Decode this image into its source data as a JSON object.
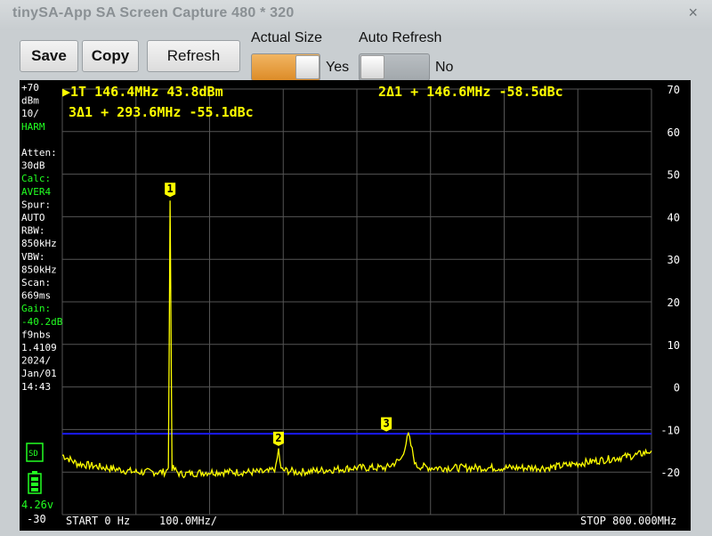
{
  "window": {
    "title": "tinySA-App SA Screen Capture   480 * 320",
    "close_glyph": "×"
  },
  "toolbar": {
    "save_label": "Save",
    "copy_label": "Copy",
    "refresh_label": "Refresh"
  },
  "actual_size": {
    "label": "Actual Size",
    "state_text": "Yes",
    "on": true
  },
  "auto_refresh": {
    "label": "Auto Refresh",
    "state_text": "No",
    "on": false
  },
  "colors": {
    "trace": "#ffff00",
    "marker_text": "#ffff00",
    "left_text": "#ffffff",
    "green_text": "#22ff22",
    "grid": "#555555",
    "threshold_line": "#1a1aff",
    "toggle_on": "#e39a33"
  },
  "screen": {
    "marker_line1": "▶1T  146.4MHz 43.8dBm",
    "marker_line2": "3Δ1 +  293.6MHz -55.1dBc",
    "marker_line3": "2Δ1 +  146.6MHz -58.5dBc",
    "left_panel": [
      {
        "text": "+70",
        "color": "white"
      },
      {
        "text": "dBm",
        "color": "white"
      },
      {
        "text": "10/",
        "color": "white"
      },
      {
        "text": "HARM",
        "color": "green"
      },
      {
        "text": "",
        "color": "white"
      },
      {
        "text": "Atten:",
        "color": "white"
      },
      {
        "text": "30dB",
        "color": "white"
      },
      {
        "text": "Calc:",
        "color": "green"
      },
      {
        "text": "AVER4",
        "color": "green"
      },
      {
        "text": "Spur:",
        "color": "white"
      },
      {
        "text": "AUTO",
        "color": "white"
      },
      {
        "text": "RBW:",
        "color": "white"
      },
      {
        "text": "850kHz",
        "color": "white"
      },
      {
        "text": "VBW:",
        "color": "white"
      },
      {
        "text": "850kHz",
        "color": "white"
      },
      {
        "text": "Scan:",
        "color": "white"
      },
      {
        "text": "669ms",
        "color": "white"
      },
      {
        "text": "Gain:",
        "color": "green"
      },
      {
        "text": "-40.2dB",
        "color": "green"
      },
      {
        "text": "f9nbs",
        "color": "white"
      },
      {
        "text": "1.4109",
        "color": "white"
      },
      {
        "text": "2024/",
        "color": "white"
      },
      {
        "text": "Jan/01",
        "color": "white"
      },
      {
        "text": "14:43",
        "color": "white"
      }
    ],
    "sd_label": "SD",
    "battery_voltage": "4.26v",
    "bottom_left_value": "-30",
    "footer_start": "START 0 Hz",
    "footer_div": "100.0MHz/",
    "footer_stop": "STOP 800.000MHz",
    "threshold_dbm": -11
  },
  "chart_data": {
    "type": "line",
    "x_unit": "MHz",
    "y_unit": "dBm",
    "xlim": [
      0,
      800
    ],
    "ylim": [
      -30,
      70
    ],
    "y_ticks": [
      70,
      60,
      50,
      40,
      30,
      20,
      10,
      0,
      -10,
      -20
    ],
    "grid": true,
    "series": [
      {
        "x": [
          0,
          20,
          40,
          60,
          80,
          100,
          120,
          140,
          144,
          146.4,
          149,
          160,
          200,
          240,
          280,
          290,
          293.6,
          297,
          320,
          360,
          400,
          440,
          460,
          470,
          480,
          500,
          540,
          580,
          620,
          660,
          700,
          720,
          740,
          760,
          780,
          800
        ],
        "y": [
          -16,
          -18,
          -18.5,
          -19,
          -19.5,
          -20,
          -20,
          -20,
          -19,
          43.8,
          -19,
          -20.5,
          -20,
          -20,
          -20,
          -19,
          -14.7,
          -19.5,
          -20,
          -19.5,
          -19,
          -19,
          -17,
          -11.3,
          -18.5,
          -19,
          -19,
          -19,
          -19,
          -19,
          -18,
          -17.5,
          -17,
          -16.5,
          -16,
          -15
        ]
      }
    ],
    "markers": [
      {
        "label": "1",
        "x": 146.4,
        "y": 43.8
      },
      {
        "label": "2",
        "x": 293.6,
        "y": -14.7
      },
      {
        "label": "3",
        "x": 440,
        "y": -11.3
      }
    ]
  }
}
